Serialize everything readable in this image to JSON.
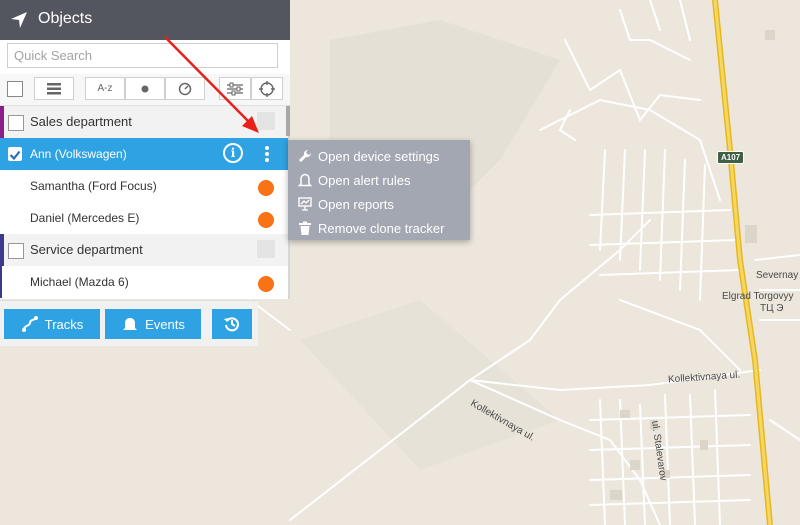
{
  "panel": {
    "title": "Objects",
    "search": {
      "placeholder": "Quick Search",
      "value": ""
    },
    "toolbar": {
      "sort_az_label": "A-z"
    },
    "groups": [
      {
        "name": "Sales department",
        "color": "#8a1f8c"
      },
      {
        "name": "Service department",
        "color": "#3b3a8c"
      }
    ],
    "objects": [
      {
        "name": "Ann (Volkswagen)",
        "selected": true
      },
      {
        "name": "Samantha (Ford Focus)",
        "status_color": "#f97316"
      },
      {
        "name": "Daniel (Mercedes E)",
        "status_color": "#f97316"
      },
      {
        "name": "Michael (Mazda 6)",
        "status_color": "#f97316"
      }
    ]
  },
  "bottom_bar": {
    "tracks_label": "Tracks",
    "events_label": "Events"
  },
  "context_menu": {
    "items": [
      {
        "label": "Open device settings",
        "icon": "wrench-icon"
      },
      {
        "label": "Open alert rules",
        "icon": "bell-icon"
      },
      {
        "label": "Open reports",
        "icon": "report-icon"
      },
      {
        "label": "Remove clone tracker",
        "icon": "trash-icon"
      }
    ]
  },
  "map": {
    "labels": [
      "A107",
      "Severnay",
      "Elgrad Torgovyy",
      "ТЦ Э",
      "Kollektivnaya ul.",
      "Kollektivnaya ul.",
      "ul. Stalevarov"
    ]
  },
  "colors": {
    "accent": "#2fa2e3",
    "header": "#54565f",
    "menu": "#a3a7b1",
    "annotation": "#e8201c"
  }
}
